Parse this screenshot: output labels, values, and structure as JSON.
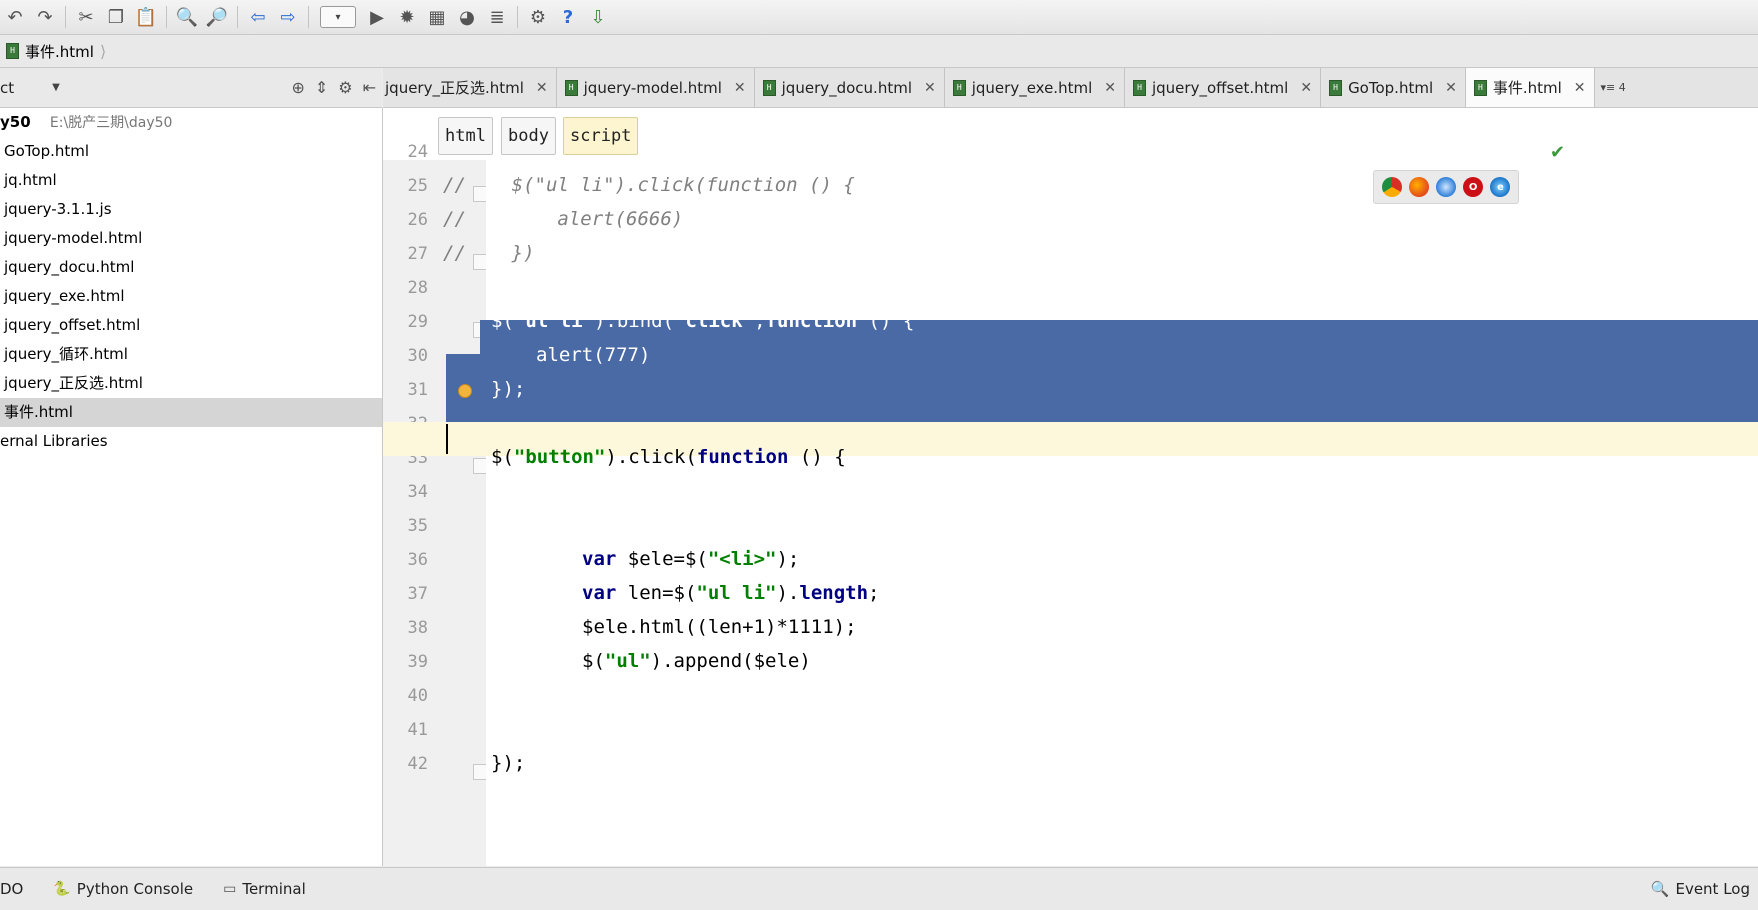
{
  "toolbar": {
    "buttons": [
      "undo-icon",
      "redo-icon",
      "cut-icon",
      "copy-icon",
      "paste-icon",
      "find-icon",
      "replace-icon",
      "back-icon",
      "forward-icon",
      "run-config-dropdown",
      "run-icon",
      "debug-icon",
      "coverage-icon",
      "profile-icon",
      "tasks-icon",
      "settings-icon",
      "help-icon",
      "update-icon"
    ]
  },
  "navbar": {
    "crumb": "事件.html"
  },
  "project": {
    "header_label": "ct",
    "root_name": "y50",
    "root_path": "E:\\脱产三期\\day50",
    "files": [
      "GoTop.html",
      "jq.html",
      "jquery-3.1.1.js",
      "jquery-model.html",
      "jquery_docu.html",
      "jquery_exe.html",
      "jquery_offset.html",
      "jquery_循环.html",
      "jquery_正反选.html",
      "事件.html"
    ],
    "external": "ernal Libraries"
  },
  "tabs": [
    {
      "label": "jquery_正反选.html"
    },
    {
      "label": "jquery-model.html"
    },
    {
      "label": "jquery_docu.html"
    },
    {
      "label": "jquery_exe.html"
    },
    {
      "label": "jquery_offset.html"
    },
    {
      "label": "GoTop.html"
    },
    {
      "label": "事件.html"
    }
  ],
  "tab_overflow": "▾≡ 4",
  "editor_crumbs": [
    "html",
    "body",
    "script"
  ],
  "code": {
    "line_numbers": [
      "24",
      "25",
      "26",
      "27",
      "28",
      "29",
      "30",
      "31",
      "32",
      "33",
      "34",
      "35",
      "36",
      "37",
      "38",
      "39",
      "40",
      "41",
      "42"
    ],
    "l25": "//    $(\"ul li\").click(function () {",
    "l26": "//        alert(6666)",
    "l27": "//    })",
    "l29_a": "$(",
    "l29_b": "\"ul li\"",
    "l29_c": ").bind(",
    "l29_d": "\"click\"",
    "l29_e": ",",
    "l29_f": "function",
    "l29_g": " () {",
    "l30": "alert(777)",
    "l31": "});",
    "l33_a": "$(",
    "l33_b": "\"button\"",
    "l33_c": ").click(",
    "l33_d": "function",
    "l33_e": " () {",
    "l36_a": "var",
    "l36_b": " $ele=$(",
    "l36_c": "\"<li>\"",
    "l36_d": ");",
    "l37_a": "var",
    "l37_b": " len=$(",
    "l37_c": "\"ul li\"",
    "l37_d": ").",
    "l37_e": "length",
    "l37_f": ";",
    "l38": "$ele.html((len+1)*1111);",
    "l39_a": "$(",
    "l39_b": "\"ul\"",
    "l39_c": ").append($ele)",
    "l42": "});"
  },
  "status": {
    "todo": "DO",
    "python_console": "Python Console",
    "terminal": "Terminal",
    "event_log": "Event Log"
  },
  "colors": {
    "selection": "#4a6aa5",
    "caret_line": "#fdf8dc",
    "keyword": "#000080",
    "string": "#008000",
    "comment": "#808080"
  }
}
